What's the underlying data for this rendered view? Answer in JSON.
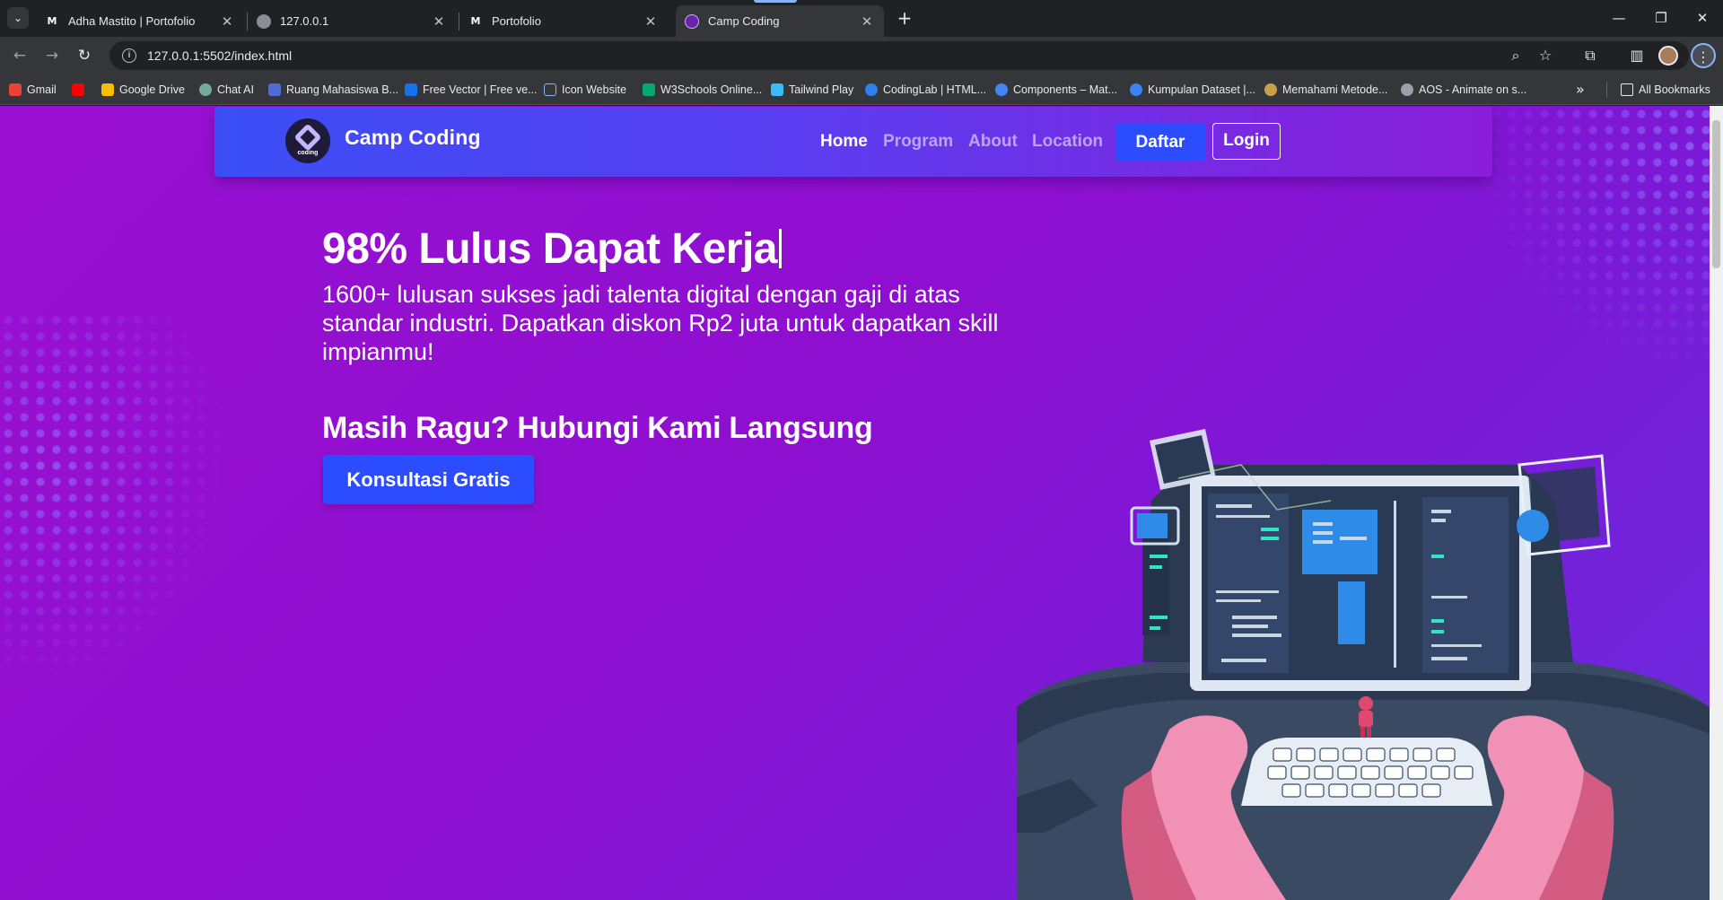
{
  "browser": {
    "tabs": [
      {
        "title": "Adha Mastito | Portofolio",
        "favicon": "M",
        "active": false
      },
      {
        "title": "127.0.0.1",
        "favicon": "globe",
        "active": false
      },
      {
        "title": "Portofolio",
        "favicon": "M",
        "active": false
      },
      {
        "title": "Camp Coding",
        "favicon": "camp-coding",
        "active": true
      }
    ],
    "url": "127.0.0.1:5502/index.html",
    "bookmarks": [
      {
        "label": "Gmail",
        "color": "#ea4335"
      },
      {
        "label": "",
        "color": "#ff0000"
      },
      {
        "label": "Google Drive",
        "color": "#fbbc04"
      },
      {
        "label": "Chat AI",
        "color": "#74aa9c"
      },
      {
        "label": "Ruang Mahasiswa B...",
        "color": "#4f6bd8"
      },
      {
        "label": "Free Vector | Free ve...",
        "color": "#1273eb"
      },
      {
        "label": "Icon Website",
        "color": "#8ab4f8"
      },
      {
        "label": "W3Schools Online...",
        "color": "#04aa6d"
      },
      {
        "label": "Tailwind Play",
        "color": "#38bdf8"
      },
      {
        "label": "CodingLab | HTML...",
        "color": "#2f80ed"
      },
      {
        "label": "Components – Mat...",
        "color": "#4285f4"
      },
      {
        "label": "Kumpulan Dataset |...",
        "color": "#3b82f6"
      },
      {
        "label": "Memahami Metode...",
        "color": "#c8a04a"
      },
      {
        "label": "AOS - Animate on s...",
        "color": "#9aa0a6"
      }
    ],
    "all_bookmarks_label": "All Bookmarks"
  },
  "page": {
    "brand": {
      "name": "Camp Coding",
      "logo_text": "coding"
    },
    "nav": {
      "links": [
        "Home",
        "Program",
        "About",
        "Location"
      ],
      "active": "Home",
      "daftar_label": "Daftar",
      "login_label": "Login"
    },
    "hero": {
      "title": "98% Lulus Dapat Kerja",
      "description": "1600+ lulusan sukses jadi talenta digital dengan gaji di atas standar industri. Dapatkan diskon Rp2 juta untuk dapatkan skill impianmu!",
      "subheading": "Masih Ragu? Hubungi Kami Langsung",
      "cta_label": "Konsultasi Gratis"
    },
    "colors": {
      "background": "#9a10d2",
      "navbar_start": "#3b4ef5",
      "navbar_end": "#8a1ed8",
      "button_blue": "#2b4dff"
    }
  }
}
